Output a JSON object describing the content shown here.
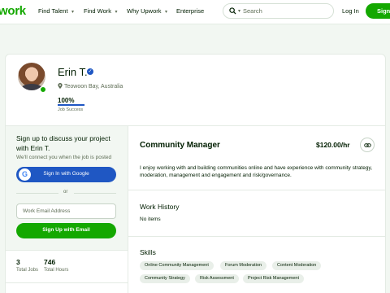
{
  "nav": {
    "logo": "work",
    "items": [
      "Find Talent",
      "Find Work",
      "Why Upwork",
      "Enterprise"
    ],
    "search_placeholder": "Search",
    "login": "Log In",
    "signup": "Sign"
  },
  "profile": {
    "name": "Erin T.",
    "location": "Teowoon Bay, Australia",
    "job_success_value": "100%",
    "job_success_fraction": 1.0,
    "job_success_label": "Job Success"
  },
  "signup_panel": {
    "heading": "Sign up to discuss your project with Erin T.",
    "subtext": "We'll connect you when the job is posted",
    "google_button": "Sign In with Google",
    "or": "or",
    "email_placeholder": "Work Email Address",
    "email_button": "Sign Up with Email"
  },
  "stats": {
    "total_jobs_value": "3",
    "total_jobs_label": "Total Jobs",
    "total_hours_value": "746",
    "total_hours_label": "Total Hours"
  },
  "main": {
    "title": "Community Manager",
    "rate": "$120.00/hr",
    "bio": "I enjoy working with and building communities online and have experience with community strategy, moderation, management and engagement and risk/governance.",
    "work_history_heading": "Work History",
    "work_history_empty": "No items",
    "skills_heading": "Skills",
    "skills": [
      "Online Community Management",
      "Forum Moderation",
      "Content Moderation",
      "Community Strategy",
      "Risk Assessment",
      "Project Risk Management"
    ]
  },
  "colors": {
    "brand_green": "#14a800",
    "google_blue": "#1f57c3"
  }
}
